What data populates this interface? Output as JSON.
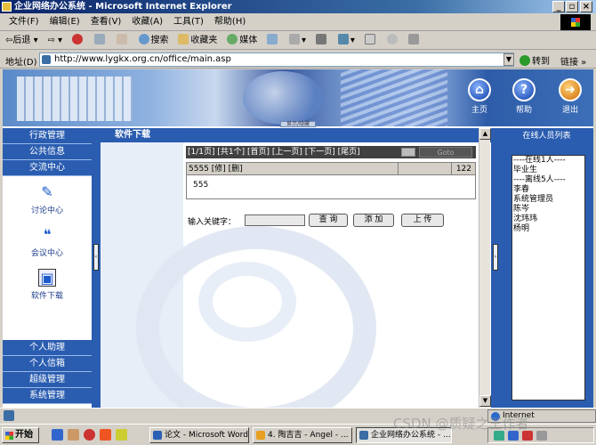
{
  "window": {
    "title": "企业网络办公系统 - Microsoft Internet Explorer",
    "btn_min": "_",
    "btn_max": "▫",
    "btn_close": "×"
  },
  "menubar": [
    "文件(F)",
    "编辑(E)",
    "查看(V)",
    "收藏(A)",
    "工具(T)",
    "帮助(H)"
  ],
  "toolbar": {
    "back": "后退",
    "search": "搜索",
    "favorites": "收藏夹",
    "media": "媒体"
  },
  "address": {
    "label": "地址(D)",
    "url": "http://www.lygkx.org.cn/office/main.asp",
    "go": "转到",
    "links": "链接 »"
  },
  "banner": {
    "home": "主页",
    "help": "帮助",
    "logout": "退出",
    "help_glyph": "?",
    "tab": "显示/隐藏"
  },
  "sidebar": {
    "top_items": [
      "行政管理",
      "公共信息",
      "交流中心"
    ],
    "icons": [
      {
        "label": "讨论中心",
        "icon": "pen-icon"
      },
      {
        "label": "会议中心",
        "icon": "chat-bubbles-icon"
      },
      {
        "label": "软件下载",
        "icon": "floppy-disk-icon"
      }
    ],
    "bottom_items": [
      "个人助理",
      "个人信箱",
      "超级管理",
      "系统管理"
    ]
  },
  "content": {
    "title": "软件下载",
    "pager": "[1/1页] [共1个] [首页] [上一页] [下一页] [尾页]",
    "goto": "Goto",
    "row": {
      "name": "5555 [修] [删]",
      "count": "122",
      "desc": "555"
    },
    "search": {
      "label": "输入关键字：",
      "query_btn": "查 询",
      "add_btn": "添 加",
      "upload_btn": "上 传"
    }
  },
  "online": {
    "title": "在线人员列表",
    "lines": [
      "----在线1人----",
      "毕业生",
      "----离线5人----",
      "李春",
      "系统管理员",
      "陈岑",
      "沈玮玮",
      "杨明"
    ]
  },
  "status": {
    "zone": "Internet"
  },
  "taskbar": {
    "start": "开始",
    "tasks": [
      "论文 - Microsoft Word",
      "4. 陶吉吉 - Angel - ...",
      "企业网络办公系统 - ..."
    ]
  },
  "watermark": "CSDN @质疑之王作者"
}
